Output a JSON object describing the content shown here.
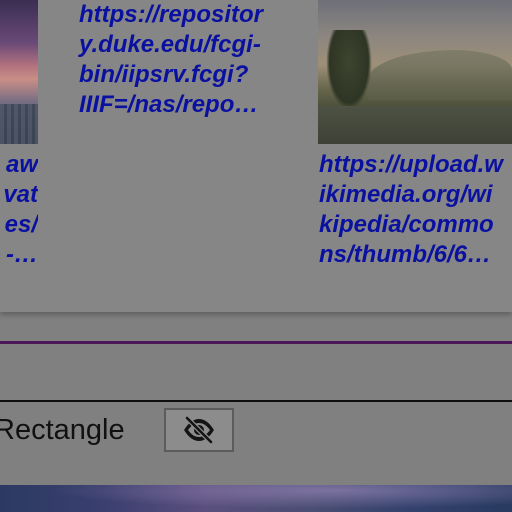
{
  "results": {
    "items": [
      {
        "link_lines": [
          "aw",
          "vat",
          "es/",
          "‑…"
        ]
      },
      {
        "link_lines": [
          "https://repositor",
          "y.duke.edu/fcgi-",
          "bin/iipsrv.fcgi?",
          "IIIF=/nas/repo…"
        ]
      },
      {
        "link_lines": [
          "https://upload.w",
          "ikimedia.org/wi",
          "kipedia/commo",
          "ns/thumb/6/6…"
        ]
      }
    ]
  },
  "layer": {
    "shape_label": "Rectangle",
    "visibility_icon": "eye-slash-icon"
  },
  "colors": {
    "link": "#0a10a0",
    "separator": "#4a1858"
  }
}
